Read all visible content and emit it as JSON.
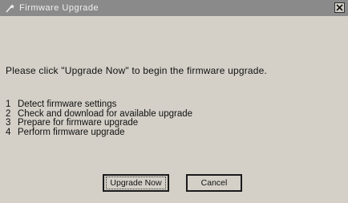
{
  "window": {
    "title": "Firmware Upgrade"
  },
  "intro_text": "Please click \"Upgrade Now\" to begin the firmware upgrade.",
  "steps": [
    {
      "num": "1",
      "text": "Detect firmware settings"
    },
    {
      "num": "2",
      "text": "Check and download for available upgrade"
    },
    {
      "num": "3",
      "text": "Prepare for firmware upgrade"
    },
    {
      "num": "4",
      "text": "Perform firmware upgrade"
    }
  ],
  "buttons": {
    "upgrade_label": "Upgrade Now",
    "cancel_label": "Cancel"
  },
  "icons": {
    "title": "wand-icon",
    "close": "close-icon"
  },
  "colors": {
    "background": "#d4d0c8",
    "titlebar": "#8a8a8a"
  }
}
